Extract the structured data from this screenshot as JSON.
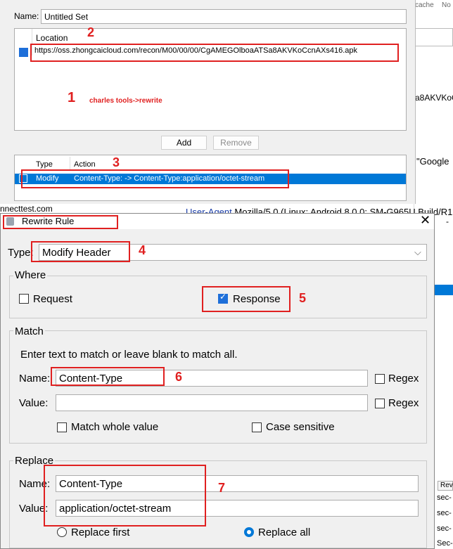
{
  "bg": {
    "right_frag_1": "cache",
    "right_frag_2": "No",
    "right_frag_3": "a8AKVKoC",
    "right_frag_4": "\"Google",
    "right_frag_5": "-",
    "left_frag_1": "nnecttest.com",
    "user_agent_label": "User-Agent",
    "user_agent_value": "Mozilla/5.0 (Linux; Android 8.0.0; SM-G965U Build/R1",
    "sec_rows": [
      "sec-",
      "sec-",
      "sec-",
      "Sec-"
    ],
    "rev_tab": "Rev"
  },
  "set_dialog": {
    "name_label": "Name:",
    "name_value": "Untitled Set",
    "location_header": "Location",
    "location_url": "https://oss.zhongcaicloud.com/recon/M00/00/00/CgAMEGOlboaATSa8AKVKoCcnAXs416.apk",
    "annotation": "charles tools->rewrite",
    "add_label": "Add",
    "remove_label": "Remove",
    "rules_col_type": "Type",
    "rules_col_action": "Action",
    "rule_type": "Modify",
    "rule_action": "Content-Type: -> Content-Type:application/octet-stream"
  },
  "rule_dialog": {
    "title": "Rewrite Rule",
    "type_label": "Type:",
    "type_value": "Modify Header",
    "where_legend": "Where",
    "request_label": "Request",
    "response_label": "Response",
    "match_legend": "Match",
    "match_hint": "Enter text to match or leave blank to match all.",
    "name_label": "Name:",
    "name_value": "Content-Type",
    "value_label": "Value:",
    "value_value": "",
    "regex_label": "Regex",
    "match_whole_label": "Match whole value",
    "case_sensitive_label": "Case sensitive",
    "replace_legend": "Replace",
    "replace_name_label": "Name:",
    "replace_name_value": "Content-Type",
    "replace_value_label": "Value:",
    "replace_value_value": "application/octet-stream",
    "replace_first_label": "Replace first",
    "replace_all_label": "Replace all"
  },
  "annotations": [
    "1",
    "2",
    "3",
    "4",
    "5",
    "6",
    "7"
  ],
  "colors": {
    "accent": "#0078d7",
    "annotation_red": "#e02020",
    "selection": "#0078d7"
  }
}
